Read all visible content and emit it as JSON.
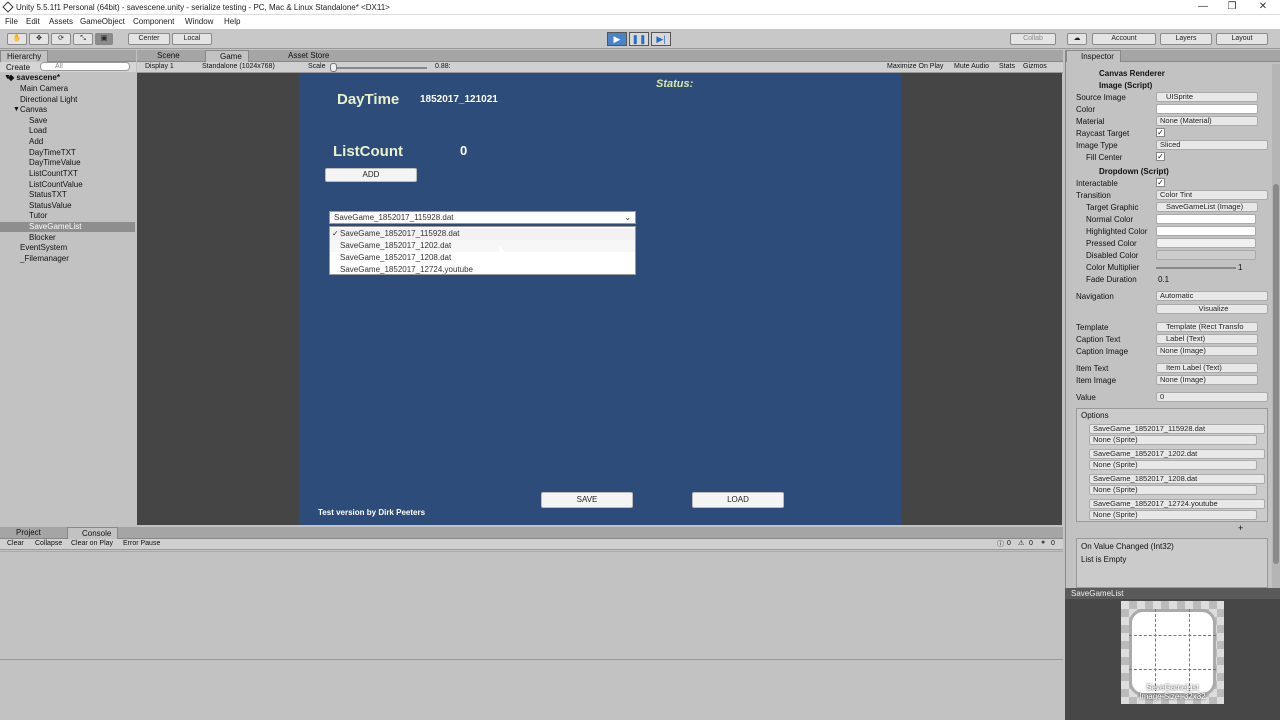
{
  "window": {
    "title": "Unity 5.5.1f1 Personal (64bit) - savescene.unity - serialize testing - PC, Mac & Linux Standalone* <DX11>",
    "min": "—",
    "max": "❐",
    "close": "✕"
  },
  "menu": [
    "File",
    "Edit",
    "Assets",
    "GameObject",
    "Component",
    "Window",
    "Help"
  ],
  "toolbar": {
    "center": "Center",
    "local": "Local",
    "collab": "Collab",
    "account": "Account",
    "layers": "Layers",
    "layout": "Layout"
  },
  "hierarchy": {
    "tab": "Hierarchy",
    "create": "Create",
    "search": "All",
    "scene": "savescene*",
    "items": [
      "Main Camera",
      "Directional Light",
      "Canvas",
      "Save",
      "Load",
      "Add",
      "DayTimeTXT",
      "DayTimeValue",
      "ListCountTXT",
      "ListCountValue",
      "StatusTXT",
      "StatusValue",
      "Tutor",
      "SaveGameList",
      "Blocker",
      "EventSystem",
      "_Filemanager"
    ]
  },
  "tabs": {
    "scene": "Scene",
    "game": "Game",
    "store": "Asset Store"
  },
  "gamebar": {
    "display": "Display 1",
    "resolution": "Standalone (1024x768)",
    "scale_label": "Scale",
    "scale_value": "0.88:",
    "maximize": "Maximize On Play",
    "mute": "Mute Audio",
    "stats": "Stats",
    "gizmos": "Gizmos"
  },
  "game": {
    "status_label": "Status:",
    "daytime_label": "DayTime",
    "daytime_value": "1852017_121021",
    "listcount_label": "ListCount",
    "listcount_value": "0",
    "add": "ADD",
    "dropdown_value": "SaveGame_1852017_115928.dat",
    "options": [
      "SaveGame_1852017_115928.dat",
      "SaveGame_1852017_1202.dat",
      "SaveGame_1852017_1208.dat",
      "SaveGame_1852017_12724.youtube"
    ],
    "check": "✓",
    "save": "SAVE",
    "load": "LOAD",
    "footer": "Test version by Dirk Peeters"
  },
  "console": {
    "project": "Project",
    "console": "Console",
    "clear": "Clear",
    "collapse": "Collapse",
    "clear_on_play": "Clear on Play",
    "error_pause": "Error Pause",
    "counts": [
      "0",
      "0",
      "0"
    ]
  },
  "inspector": {
    "tab": "Inspector",
    "canvas_renderer": "Canvas Renderer",
    "image_script": "Image (Script)",
    "image_rows": [
      [
        "Source Image",
        "UISprite"
      ],
      [
        "Color",
        ""
      ],
      [
        "Material",
        "None (Material)"
      ],
      [
        "Raycast Target",
        ""
      ],
      [
        "Image Type",
        "Sliced"
      ],
      [
        "Fill Center",
        ""
      ]
    ],
    "dropdown_script": "Dropdown (Script)",
    "dd_rows": [
      [
        "Interactable",
        ""
      ],
      [
        "Transition",
        "Color Tint"
      ],
      [
        "Target Graphic",
        "SaveGameList (Image)"
      ],
      [
        "Normal Color",
        ""
      ],
      [
        "Highlighted Color",
        ""
      ],
      [
        "Pressed Color",
        ""
      ],
      [
        "Disabled Color",
        ""
      ],
      [
        "Color Multiplier",
        "1"
      ],
      [
        "Fade Duration",
        "0.1"
      ]
    ],
    "navigation": "Navigation",
    "navigation_value": "Automatic",
    "visualize": "Visualize",
    "tpl_rows": [
      [
        "Template",
        "Template (Rect Transfo"
      ],
      [
        "Caption Text",
        "Label (Text)"
      ],
      [
        "Caption Image",
        "None (Image)"
      ],
      [
        "Item Text",
        "Item Label (Text)"
      ],
      [
        "Item Image",
        "None (Image)"
      ],
      [
        "Value",
        "0"
      ]
    ],
    "options_label": "Options",
    "options": [
      [
        "SaveGame_1852017_115928.dat",
        "None (Sprite)"
      ],
      [
        "SaveGame_1852017_1202.dat",
        "None (Sprite)"
      ],
      [
        "SaveGame_1852017_1208.dat",
        "None (Sprite)"
      ],
      [
        "SaveGame_1852017_12724.youtube",
        "None (Sprite)"
      ]
    ],
    "plus": "+",
    "on_value_changed": "On Value Changed (Int32)",
    "list_empty": "List is Empty",
    "preview_title": "SaveGameList",
    "preview_caption1": "SaveGameList",
    "preview_caption2": "Image Size: 32x32"
  }
}
